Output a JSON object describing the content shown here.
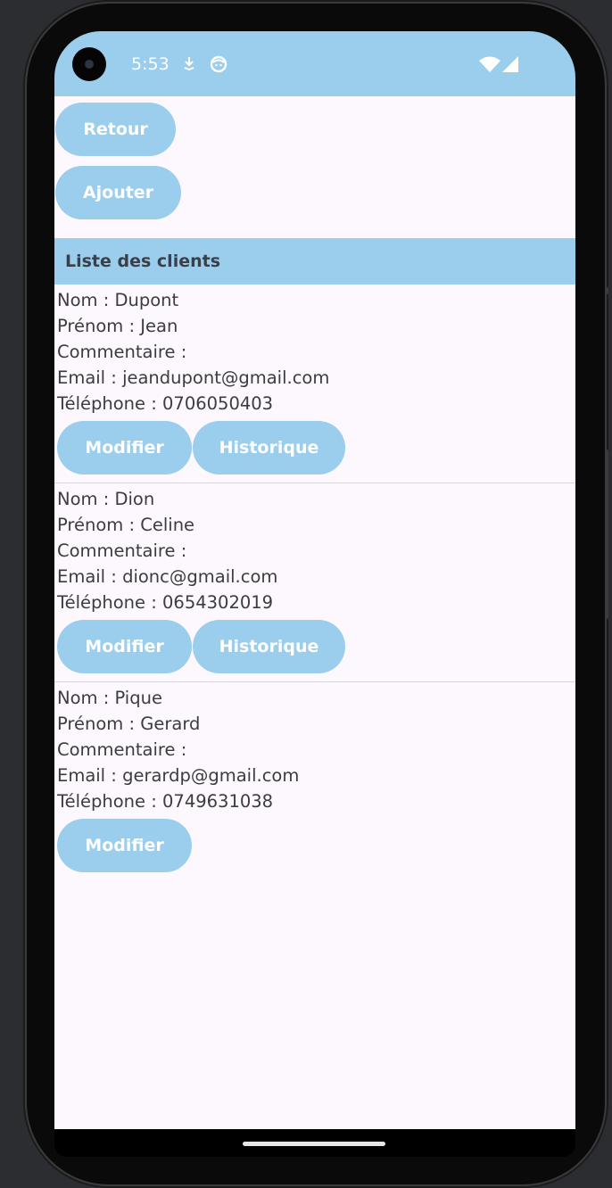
{
  "status_bar": {
    "time": "5:53",
    "background": "#9bcdec"
  },
  "toolbar": {
    "back_label": "Retour",
    "add_label": "Ajouter"
  },
  "list": {
    "header": "Liste des clients"
  },
  "clients": [
    {
      "nom": "Nom : Dupont",
      "prenom": "Prénom : Jean",
      "commentaire": "Commentaire :",
      "email": "Email : jeandupont@gmail.com",
      "telephone": "Téléphone : 0706050403",
      "modify_label": "Modifier",
      "history_label": "Historique"
    },
    {
      "nom": "Nom : Dion",
      "prenom": "Prénom : Celine",
      "commentaire": "Commentaire :",
      "email": "Email : dionc@gmail.com",
      "telephone": "Téléphone : 0654302019",
      "modify_label": "Modifier",
      "history_label": "Historique"
    },
    {
      "nom": "Nom : Pique",
      "prenom": "Prénom : Gerard",
      "commentaire": "Commentaire :",
      "email": "Email : gerardp@gmail.com",
      "telephone": "Téléphone : 0749631038",
      "modify_label": "Modifier"
    }
  ],
  "theme": {
    "accent": "#9bcdec",
    "surface": "#fdf8fd",
    "text": "#3c3c40"
  }
}
